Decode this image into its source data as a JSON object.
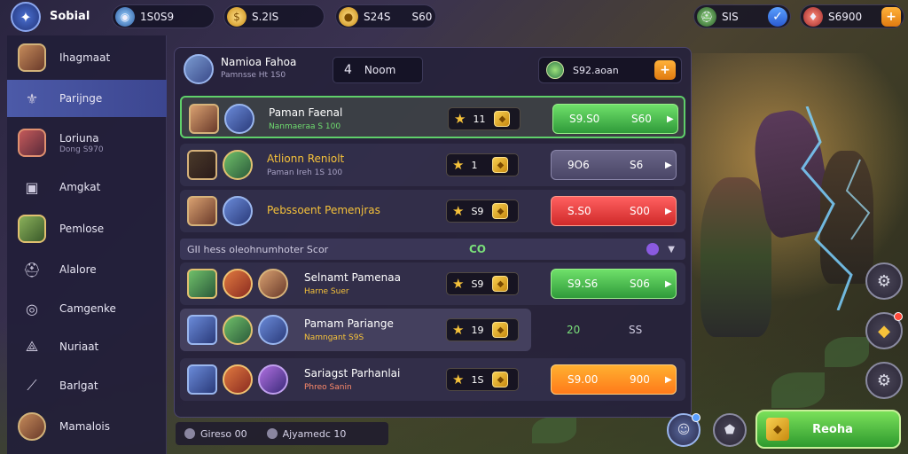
{
  "topbar": {
    "brand": "Sobial",
    "currencies": [
      {
        "icon": "energy-icon",
        "value": "1S0S9"
      },
      {
        "icon": "coin-icon",
        "value": "S.2IS"
      },
      {
        "icon": "gold-icon",
        "value": "S24S",
        "extra": "S60"
      }
    ],
    "right": [
      {
        "icon": "helmet-icon",
        "value": "SIS"
      },
      {
        "icon": "ruby-icon",
        "value": "S6900"
      }
    ]
  },
  "sidebar": {
    "items": [
      {
        "label": "Ihagmaat",
        "sub": "",
        "icon": "hero-portrait-icon"
      },
      {
        "label": "Parijnge",
        "sub": "",
        "icon": "crest-icon",
        "active": true
      },
      {
        "label": "Loriuna",
        "sub": "Dong S970",
        "icon": "hero-portrait-icon"
      },
      {
        "label": "Amgkat",
        "sub": "",
        "icon": "chest-icon"
      },
      {
        "label": "Pemlose",
        "sub": "",
        "icon": "hero-portrait-icon"
      },
      {
        "label": "Alalore",
        "sub": "",
        "icon": "helmet-icon"
      },
      {
        "label": "Camgenke",
        "sub": "",
        "icon": "swirl-icon"
      },
      {
        "label": "Nuriaat",
        "sub": "",
        "icon": "wing-icon"
      },
      {
        "label": "Barlgat",
        "sub": "",
        "icon": "blade-icon"
      },
      {
        "label": "Mamalois",
        "sub": "",
        "icon": "hero-portrait-icon"
      }
    ]
  },
  "panel": {
    "title": "Namioa Fahoa",
    "subtitle": "Pamnsse Ht 1S0",
    "box_num": "4",
    "box_text": "Noom",
    "gem_text": "S92.aoan",
    "rows": [
      {
        "title": "Paman Faenal",
        "sub": "Nanmaeraa S 100",
        "sub_color": "#6fdc6f",
        "stars": "11",
        "price_a": "S9.S0",
        "price_b": "S60",
        "style": "green",
        "selected": true,
        "heads": [
          "h1",
          "h2"
        ]
      },
      {
        "title": "Atlionn Reniolt",
        "sub": "Paman Ireh 1S 100",
        "sub_color": "#a8a2c4",
        "stars": "1",
        "price_a": "9O6",
        "price_b": "S6",
        "style": "grey",
        "title_color": "#f6c23a",
        "heads": [
          "h6",
          "h3"
        ]
      },
      {
        "title": "Pebssoent Pemenjras",
        "sub": "",
        "sub_color": "#a8a2c4",
        "stars": "S9",
        "price_a": "S.S0",
        "price_b": "S00",
        "style": "red",
        "title_color": "#f6c23a",
        "heads": [
          "h1",
          "h2"
        ]
      }
    ],
    "section": {
      "text": "GII hess oleohnumhoter Scor",
      "count": "CO"
    },
    "rows2": [
      {
        "title": "Selnamt Pamenaa",
        "sub": "Harne Suer",
        "stars": "S9",
        "price_a": "S9.S6",
        "price_b": "S06",
        "style": "green",
        "heads": [
          "h3",
          "h4",
          "h1"
        ]
      },
      {
        "title": "Pamam Pariange",
        "sub": "Namngant S9S",
        "stars": "19",
        "price_a": "20",
        "price_b": "SS",
        "style": "plain",
        "highlight": true,
        "heads": [
          "h2",
          "h3",
          "h2"
        ]
      },
      {
        "title": "Sariagst Parhanlai",
        "sub": "Phreo Sanin",
        "stars": "1S",
        "price_a": "S9.00",
        "price_b": "900",
        "style": "orange",
        "heads": [
          "h2",
          "h4",
          "h5"
        ]
      }
    ]
  },
  "bottom": {
    "left": "Gireso 00",
    "right": "Ajyamedc 10"
  },
  "start_label": "Reoha",
  "colors": {
    "accent_green": "#6fdc6f",
    "accent_gold": "#f6c23a",
    "panel_bg": "#26223c"
  }
}
